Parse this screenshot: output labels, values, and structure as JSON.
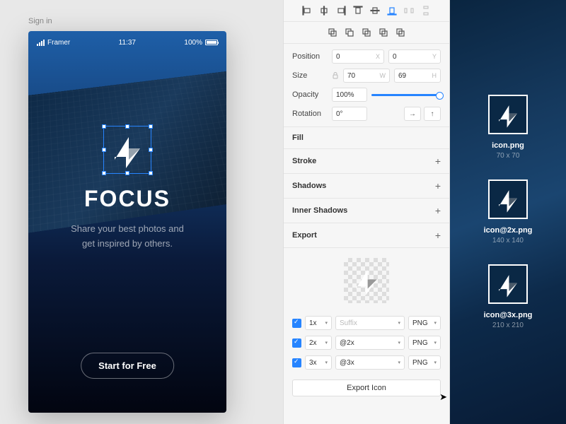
{
  "signin": "Sign in",
  "statusBar": {
    "carrier": "Framer",
    "time": "11:37",
    "battery": "100%"
  },
  "app": {
    "title": "FOCUS",
    "subtitle1": "Share your best photos and",
    "subtitle2": "get inspired by others.",
    "cta": "Start for Free"
  },
  "inspector": {
    "position": {
      "label": "Position",
      "x": "0",
      "y": "0"
    },
    "size": {
      "label": "Size",
      "w": "70",
      "h": "69"
    },
    "opacity": {
      "label": "Opacity",
      "value": "100%"
    },
    "rotation": {
      "label": "Rotation",
      "value": "0°"
    },
    "sections": {
      "fill": "Fill",
      "stroke": "Stroke",
      "shadows": "Shadows",
      "innerShadows": "Inner Shadows",
      "export": "Export"
    },
    "exportRows": [
      {
        "scale": "1x",
        "suffix": "Suffix",
        "format": "PNG"
      },
      {
        "scale": "2x",
        "suffix": "@2x",
        "format": "PNG"
      },
      {
        "scale": "3x",
        "suffix": "@3x",
        "format": "PNG"
      }
    ],
    "exportButton": "Export Icon"
  },
  "outputs": [
    {
      "name": "icon.png",
      "dim": "70 x 70"
    },
    {
      "name": "icon@2x.png",
      "dim": "140 x 140"
    },
    {
      "name": "icon@3x.png",
      "dim": "210 x 210"
    }
  ]
}
